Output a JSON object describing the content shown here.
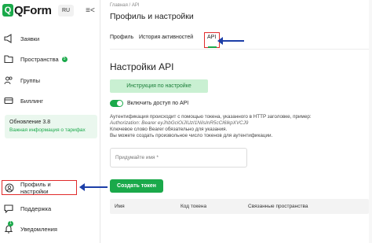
{
  "app": {
    "logo_letter": "Q",
    "logo_text": "QForm",
    "lang": "RU",
    "collapse_icon": "≡<"
  },
  "sidebar": {
    "items": [
      {
        "label": "Заявки",
        "icon": "megaphone-icon"
      },
      {
        "label": "Пространства",
        "icon": "folder-icon",
        "badge": "5"
      },
      {
        "label": "Группы",
        "icon": "users-icon"
      },
      {
        "label": "Биллинг",
        "icon": "card-icon"
      }
    ],
    "update": {
      "title": "Обновление 3.8",
      "link": "Важная информация о тарифах"
    },
    "profile_label": "Профиль и настройки",
    "support_label": "Поддержка",
    "notifications_label": "Уведомления",
    "notifications_badge": "1"
  },
  "main": {
    "breadcrumb": "Главная  /  API",
    "title": "Профиль и настройки",
    "tabs": [
      "Профиль",
      "История активностей",
      "API"
    ],
    "active_tab": "API",
    "section_title": "Настройки API",
    "instruction_button": "Инструкция по настройке",
    "toggle_label": "Включить доступ по API",
    "toggle_on": true,
    "desc_lines": [
      "Аутентификация происходит с помощью токена, указанного в HTTP заголовке, пример:",
      "Authorization: Bearer eyJhbGciOiJIUzI1NiIsInR5cCI6IkpXVCJ9",
      "Ключевое слово Bearer обязательно для указания.",
      "Вы можете создать произвольное число токенов для аутентификации."
    ],
    "token_placeholder": "Придумайте имя *",
    "create_button": "Создать токен",
    "table_headers": [
      "Имя",
      "Код токена",
      "Связанные пространства"
    ]
  },
  "colors": {
    "accent": "#1aa94a",
    "highlight": "#e02b2b",
    "arrow": "#1d3fa8"
  }
}
